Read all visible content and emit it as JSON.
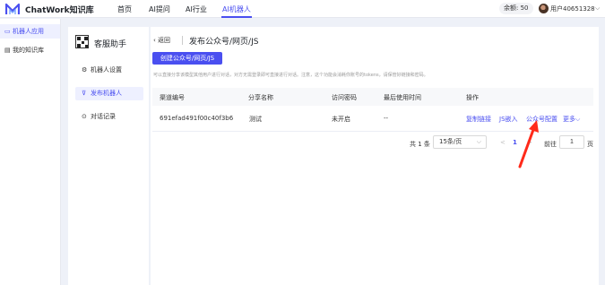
{
  "topbar": {
    "brand": "ChatWork知识库",
    "nav": [
      "首页",
      "AI提问",
      "AI行业",
      "AI机器人"
    ],
    "balance": "余额:  50",
    "user": "用户40651328",
    "chevron": "⌵"
  },
  "sidebar": {
    "items": [
      {
        "icon": "▭",
        "label": "机器人应用"
      },
      {
        "icon": "▤",
        "label": "我的知识库"
      }
    ]
  },
  "panel": {
    "title": "客服助手",
    "items": [
      {
        "icon": "⚙",
        "label": "机器人设置"
      },
      {
        "icon": "⊽",
        "label": "发布机器人"
      },
      {
        "icon": "⊙",
        "label": "对话记录"
      }
    ]
  },
  "main": {
    "back": "‹  返回",
    "title": "发布公众号/网页/JS",
    "create_button": "创建公众号/网页/JS",
    "notice": "可以直接分享该模型其他用户进行对话，对方无需登录即可直接进行对话。注意，这个功能会消耗你账号的tokens，请保管好链接和密码。",
    "columns": [
      "渠道编号",
      "分享名称",
      "访问密码",
      "最后使用时间",
      "操作"
    ],
    "rows": [
      {
        "id": "691efad491f00c40f3b6",
        "name": "测试",
        "password": "未开启",
        "last_used": "--"
      }
    ],
    "actions": [
      "复制链接",
      "JS嵌入",
      "公众号配置",
      "更多⌵"
    ]
  },
  "pagination": {
    "total": "共 1 条",
    "page_size": "15条/页",
    "size_chevron": "⌵",
    "prev": "<",
    "current": "1",
    "next": ">",
    "goto_label": "前往",
    "goto_value": "1",
    "page_suffix": "页"
  },
  "colors": {
    "accent": "#4a4ff0",
    "annotation": "#ff2a1a"
  }
}
